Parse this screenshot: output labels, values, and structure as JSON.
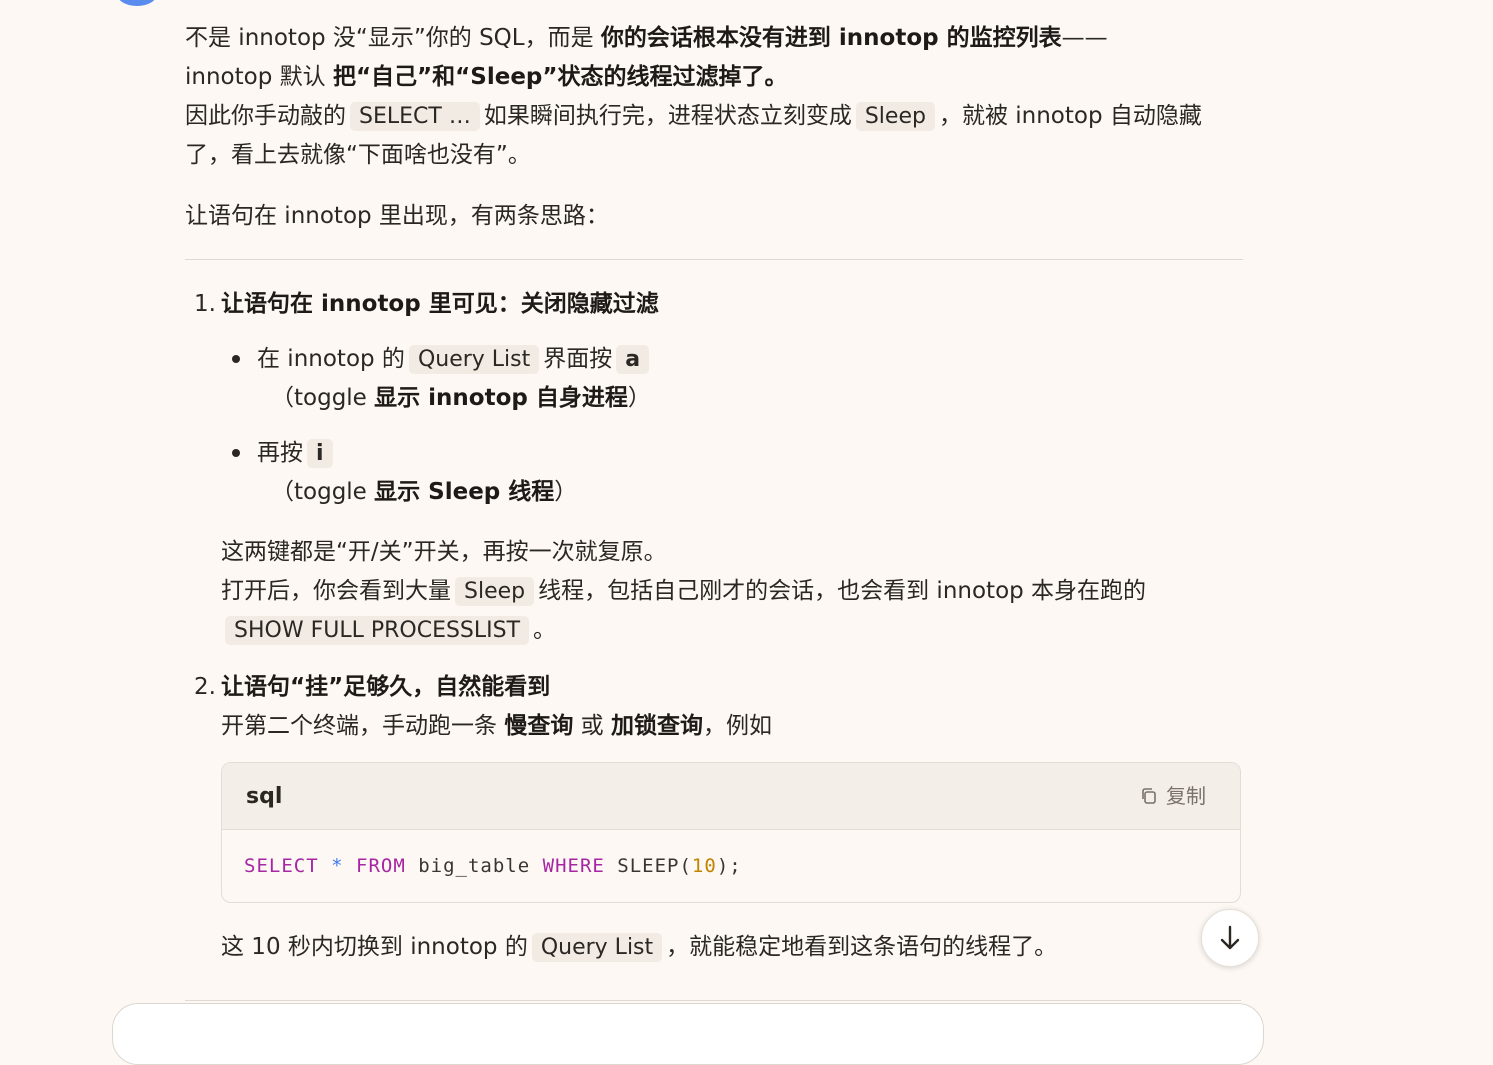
{
  "intro": {
    "l1_a": "不是 innotop 没“显示”你的 SQL，而是 ",
    "l1_b": "你的会话根本没有进到 innotop 的监控列表",
    "l1_c": "——",
    "l2_a": "innotop 默认 ",
    "l2_b": "把“自己”和“Sleep”状态的线程过滤掉了。",
    "l3_a": "因此你手动敲的",
    "l3_code1": "SELECT …",
    "l3_b": "如果瞬间执行完，进程状态立刻变成",
    "l3_code2": "Sleep",
    "l3_c": "，就被 innotop 自动隐藏",
    "l4": "了，看上去就像“下面啥也没有”。",
    "l5": "让语句在 innotop 里出现，有两条思路："
  },
  "step1": {
    "num": "1.",
    "title": "让语句在 innotop 里可见：关闭隐藏过滤",
    "b1_a": "在 innotop 的",
    "b1_code": "Query List",
    "b1_b": "界面按",
    "b1_key": "a",
    "b1_l2_a": "（toggle ",
    "b1_l2_b": "显示 innotop 自身进程",
    "b1_l2_c": "）",
    "b2_a": "再按",
    "b2_key": "i",
    "b2_l2_a": "（toggle ",
    "b2_l2_b": "显示 Sleep 线程",
    "b2_l2_c": "）",
    "p1": "这两键都是“开/关”开关，再按一次就复原。",
    "p2_a": "打开后，你会看到大量",
    "p2_code": "Sleep",
    "p2_b": "线程，包括自己刚才的会话，也会看到 innotop 本身在跑的",
    "p3_code": "SHOW FULL PROCESSLIST",
    "p3_b": "。"
  },
  "step2": {
    "num": "2.",
    "title": "让语句“挂”足够久，自然能看到",
    "d_a": "开第二个终端，手动跑一条 ",
    "d_b": "慢查询",
    "d_c": " 或 ",
    "d_d": "加锁查询",
    "d_e": "，例如",
    "code_lang": "sql",
    "copy_label": "复制",
    "code": {
      "t1": "SELECT",
      "t2": "*",
      "t3": "FROM",
      "t4": "big_table",
      "t5": "WHERE",
      "t6": "SLEEP(",
      "t7": "10",
      "t8": ");"
    },
    "after_a": "这 10 秒内切换到 innotop 的",
    "after_code": "Query List",
    "after_b": "，就能稳定地看到这条语句的线程了。"
  },
  "icons": {
    "copy": "copy-icon",
    "scroll": "arrow-down-icon"
  }
}
